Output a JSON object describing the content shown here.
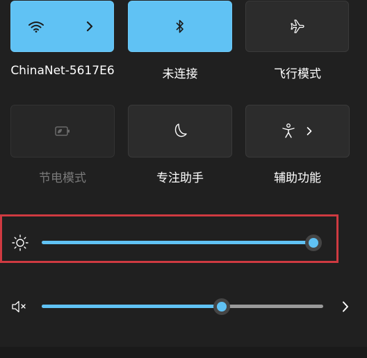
{
  "tiles": [
    {
      "label": "ChinaNet-5617E6",
      "icon": "wifi-icon",
      "state": "on",
      "has_chevron": true
    },
    {
      "label": "未连接",
      "icon": "bluetooth-icon",
      "state": "on",
      "has_chevron": false
    },
    {
      "label": "飞行模式",
      "icon": "airplane-icon",
      "state": "off",
      "has_chevron": false
    },
    {
      "label": "节电模式",
      "icon": "battery-saver-icon",
      "state": "disabled",
      "has_chevron": false
    },
    {
      "label": "专注助手",
      "icon": "moon-icon",
      "state": "off",
      "has_chevron": false
    },
    {
      "label": "辅助功能",
      "icon": "accessibility-icon",
      "state": "off",
      "has_chevron": true
    }
  ],
  "brightness": {
    "icon": "sun-icon",
    "level": 0.93
  },
  "volume": {
    "icon": "speaker-muted-icon",
    "level": 0.64,
    "next_icon": "chevron-right-icon"
  },
  "colors": {
    "accent": "#60c2f4",
    "highlight": "#cf3a41"
  }
}
